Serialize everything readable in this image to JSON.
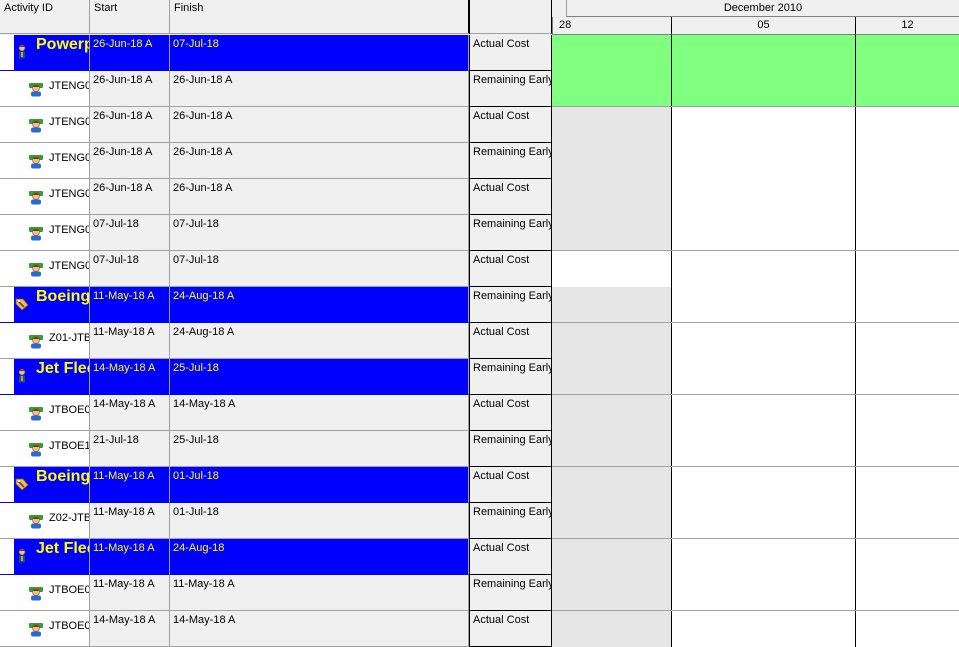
{
  "columns": {
    "activity_id": "Activity ID",
    "start": "Start",
    "finish": "Finish",
    "type": ""
  },
  "timescale": {
    "month": "December 2010",
    "days": [
      "28",
      "05",
      "12"
    ]
  },
  "colors": {
    "group_bg": "#0000ff",
    "group_text": "#ffff00",
    "bar_green": "#80ff80",
    "shade_grey": "#e6e6e6"
  },
  "rows": [
    {
      "kind": "group",
      "icon": "project-manager-icon",
      "id": "Powerp",
      "start": "26-Jun-18 A",
      "finish": "07-Jul-18",
      "type": "Actual Cost"
    },
    {
      "kind": "activity",
      "icon": "resource-user-icon",
      "id": "JTENG0",
      "start": "26-Jun-18 A",
      "finish": "26-Jun-18 A",
      "type": "Remaining Early"
    },
    {
      "kind": "activity",
      "icon": "resource-user-icon",
      "id": "JTENG0",
      "start": "26-Jun-18 A",
      "finish": "26-Jun-18 A",
      "type": "Actual Cost"
    },
    {
      "kind": "activity",
      "icon": "resource-user-icon",
      "id": "JTENG0",
      "start": "26-Jun-18 A",
      "finish": "26-Jun-18 A",
      "type": "Remaining Early"
    },
    {
      "kind": "activity",
      "icon": "resource-user-icon",
      "id": "JTENG0",
      "start": "26-Jun-18 A",
      "finish": "26-Jun-18 A",
      "type": "Actual Cost"
    },
    {
      "kind": "activity",
      "icon": "resource-user-icon",
      "id": "JTENG0",
      "start": "07-Jul-18",
      "finish": "07-Jul-18",
      "type": "Remaining Early"
    },
    {
      "kind": "activity",
      "icon": "resource-user-icon",
      "id": "JTENG0",
      "start": "07-Jul-18",
      "finish": "07-Jul-18",
      "type": "Actual Cost"
    },
    {
      "kind": "group",
      "icon": "wbs-folder-icon",
      "id": "Boeing",
      "start": "11-May-18 A",
      "finish": "24-Aug-18 A",
      "type": "Remaining Early"
    },
    {
      "kind": "activity",
      "icon": "resource-user-icon",
      "id": "Z01-JTB",
      "start": "11-May-18 A",
      "finish": "24-Aug-18 A",
      "type": "Actual Cost"
    },
    {
      "kind": "group",
      "icon": "project-manager-icon",
      "id": "Jet Flee",
      "start": "14-May-18 A",
      "finish": "25-Jul-18",
      "type": "Remaining Early"
    },
    {
      "kind": "activity",
      "icon": "resource-user-icon",
      "id": "JTBOE0",
      "start": "14-May-18 A",
      "finish": "14-May-18 A",
      "type": "Actual Cost"
    },
    {
      "kind": "activity",
      "icon": "resource-user-icon",
      "id": "JTBOE1",
      "start": "21-Jul-18",
      "finish": "25-Jul-18",
      "type": "Remaining Early"
    },
    {
      "kind": "group",
      "icon": "wbs-folder-icon",
      "id": "Boeing",
      "start": "11-May-18 A",
      "finish": "01-Jul-18",
      "type": "Actual Cost"
    },
    {
      "kind": "activity",
      "icon": "resource-user-icon",
      "id": "Z02-JTB",
      "start": "11-May-18 A",
      "finish": "01-Jul-18",
      "type": "Remaining Early"
    },
    {
      "kind": "group",
      "icon": "project-manager-icon",
      "id": "Jet Flee",
      "start": "11-May-18 A",
      "finish": "24-Aug-18",
      "type": "Actual Cost"
    },
    {
      "kind": "activity",
      "icon": "resource-user-icon",
      "id": "JTBOE0",
      "start": "11-May-18 A",
      "finish": "11-May-18 A",
      "type": "Remaining Early"
    },
    {
      "kind": "activity",
      "icon": "resource-user-icon",
      "id": "JTBOE0",
      "start": "14-May-18 A",
      "finish": "14-May-18 A",
      "type": "Actual Cost"
    }
  ]
}
